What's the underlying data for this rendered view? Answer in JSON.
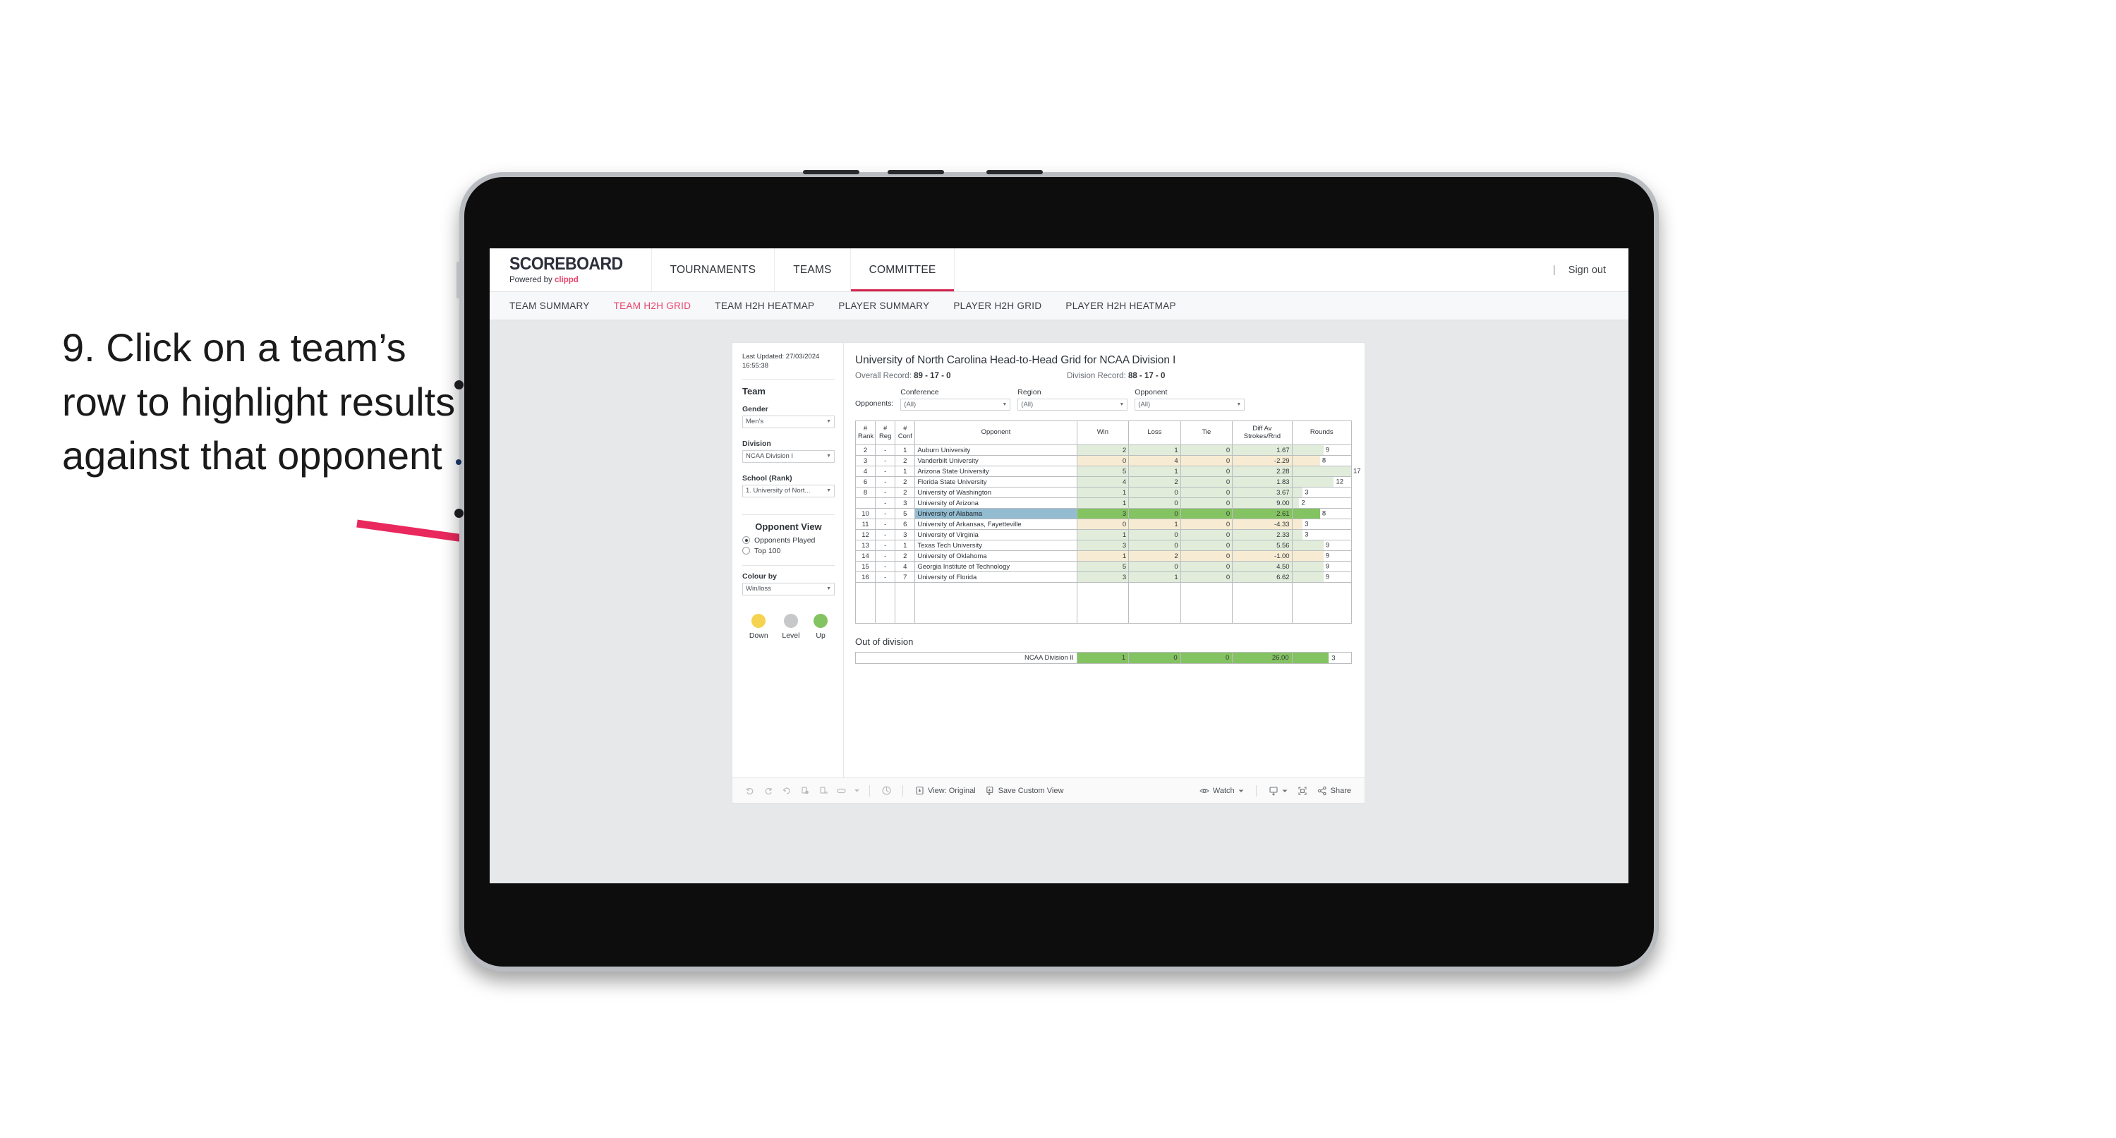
{
  "caption": {
    "text": "9. Click on a team’s row to highlight results against that opponent"
  },
  "brand": {
    "main": "SCOREBOARD",
    "sub_prefix": "Powered by ",
    "sub_brand": "clippd"
  },
  "topnav": {
    "items": [
      {
        "label": "TOURNAMENTS",
        "active": false
      },
      {
        "label": "TEAMS",
        "active": false
      },
      {
        "label": "COMMITTEE",
        "active": true
      }
    ],
    "separator": "|",
    "signout": "Sign out"
  },
  "subnav": {
    "items": [
      {
        "label": "TEAM SUMMARY",
        "active": false
      },
      {
        "label": "TEAM H2H GRID",
        "active": true
      },
      {
        "label": "TEAM H2H HEATMAP",
        "active": false
      },
      {
        "label": "PLAYER SUMMARY",
        "active": false
      },
      {
        "label": "PLAYER H2H GRID",
        "active": false
      },
      {
        "label": "PLAYER H2H HEATMAP",
        "active": false
      }
    ]
  },
  "panel": {
    "last_updated": "Last Updated: 27/03/2024 16:55:38",
    "team_heading": "Team",
    "gender_label": "Gender",
    "gender_value": "Men’s",
    "division_label": "Division",
    "division_value": "NCAA Division I",
    "school_label": "School (Rank)",
    "school_value": "1. University of Nort...",
    "opponent_view_heading": "Opponent View",
    "opponent_view_options": [
      {
        "label": "Opponents Played",
        "selected": true
      },
      {
        "label": "Top 100",
        "selected": false
      }
    ],
    "colour_by_label": "Colour by",
    "colour_by_value": "Win/loss",
    "legend": [
      {
        "label": "Down",
        "color": "#f5d24f"
      },
      {
        "label": "Level",
        "color": "#c6c8ca"
      },
      {
        "label": "Up",
        "color": "#84c361"
      }
    ]
  },
  "content": {
    "title": "University of North Carolina Head-to-Head Grid for NCAA Division I",
    "overall_record_label": "Overall Record:",
    "overall_record_value": "89 - 17 - 0",
    "division_record_label": "Division Record:",
    "division_record_value": "88 - 17 - 0",
    "opponents_label": "Opponents:",
    "filters": [
      {
        "label": "Conference",
        "value": "(All)"
      },
      {
        "label": "Region",
        "value": "(All)"
      },
      {
        "label": "Opponent",
        "value": "(All)"
      }
    ],
    "out_of_division_title": "Out of division"
  },
  "chart_data": {
    "type": "table",
    "title": "University of North Carolina Head-to-Head Grid for NCAA Division I",
    "columns": [
      "# Rank",
      "# Reg",
      "# Conf",
      "Opponent",
      "Win",
      "Loss",
      "Tie",
      "Diff Av Strokes/Rnd",
      "Rounds"
    ],
    "rounds_max": 17,
    "rows": [
      {
        "rank": "2",
        "reg": "-",
        "conf": "1",
        "opponent": "Auburn University",
        "win": "2",
        "loss": "1",
        "tie": "0",
        "diff": "1.67",
        "rounds": "9",
        "result": "up",
        "selected": false
      },
      {
        "rank": "3",
        "reg": "-",
        "conf": "2",
        "opponent": "Vanderbilt University",
        "win": "0",
        "loss": "4",
        "tie": "0",
        "diff": "-2.29",
        "rounds": "8",
        "result": "down",
        "selected": false
      },
      {
        "rank": "4",
        "reg": "-",
        "conf": "1",
        "opponent": "Arizona State University",
        "win": "5",
        "loss": "1",
        "tie": "0",
        "diff": "2.28",
        "rounds": "17",
        "result": "up",
        "selected": false
      },
      {
        "rank": "6",
        "reg": "-",
        "conf": "2",
        "opponent": "Florida State University",
        "win": "4",
        "loss": "2",
        "tie": "0",
        "diff": "1.83",
        "rounds": "12",
        "result": "up",
        "selected": false
      },
      {
        "rank": "8",
        "reg": "-",
        "conf": "2",
        "opponent": "University of Washington",
        "win": "1",
        "loss": "0",
        "tie": "0",
        "diff": "3.67",
        "rounds": "3",
        "result": "up",
        "selected": false
      },
      {
        "rank": "",
        "reg": "-",
        "conf": "3",
        "opponent": "University of Arizona",
        "win": "1",
        "loss": "0",
        "tie": "0",
        "diff": "9.00",
        "rounds": "2",
        "result": "up",
        "selected": false
      },
      {
        "rank": "10",
        "reg": "-",
        "conf": "5",
        "opponent": "University of Alabama",
        "win": "3",
        "loss": "0",
        "tie": "0",
        "diff": "2.61",
        "rounds": "8",
        "result": "up",
        "selected": true
      },
      {
        "rank": "11",
        "reg": "-",
        "conf": "6",
        "opponent": "University of Arkansas, Fayetteville",
        "win": "0",
        "loss": "1",
        "tie": "0",
        "diff": "-4.33",
        "rounds": "3",
        "result": "down",
        "selected": false
      },
      {
        "rank": "12",
        "reg": "-",
        "conf": "3",
        "opponent": "University of Virginia",
        "win": "1",
        "loss": "0",
        "tie": "0",
        "diff": "2.33",
        "rounds": "3",
        "result": "up",
        "selected": false
      },
      {
        "rank": "13",
        "reg": "-",
        "conf": "1",
        "opponent": "Texas Tech University",
        "win": "3",
        "loss": "0",
        "tie": "0",
        "diff": "5.56",
        "rounds": "9",
        "result": "up",
        "selected": false
      },
      {
        "rank": "14",
        "reg": "-",
        "conf": "2",
        "opponent": "University of Oklahoma",
        "win": "1",
        "loss": "2",
        "tie": "0",
        "diff": "-1.00",
        "rounds": "9",
        "result": "down",
        "selected": false
      },
      {
        "rank": "15",
        "reg": "-",
        "conf": "4",
        "opponent": "Georgia Institute of Technology",
        "win": "5",
        "loss": "0",
        "tie": "0",
        "diff": "4.50",
        "rounds": "9",
        "result": "up",
        "selected": false
      },
      {
        "rank": "16",
        "reg": "-",
        "conf": "7",
        "opponent": "University of Florida",
        "win": "3",
        "loss": "1",
        "tie": "0",
        "diff": "6.62",
        "rounds": "9",
        "result": "up",
        "selected": false
      }
    ],
    "out_of_division": [
      {
        "label": "NCAA Division II",
        "win": "1",
        "loss": "0",
        "tie": "0",
        "diff": "26.00",
        "rounds": "3"
      }
    ]
  },
  "toolbar": {
    "view_label": "View: Original",
    "save_label": "Save Custom View",
    "watch_label": "Watch",
    "share_label": "Share"
  }
}
